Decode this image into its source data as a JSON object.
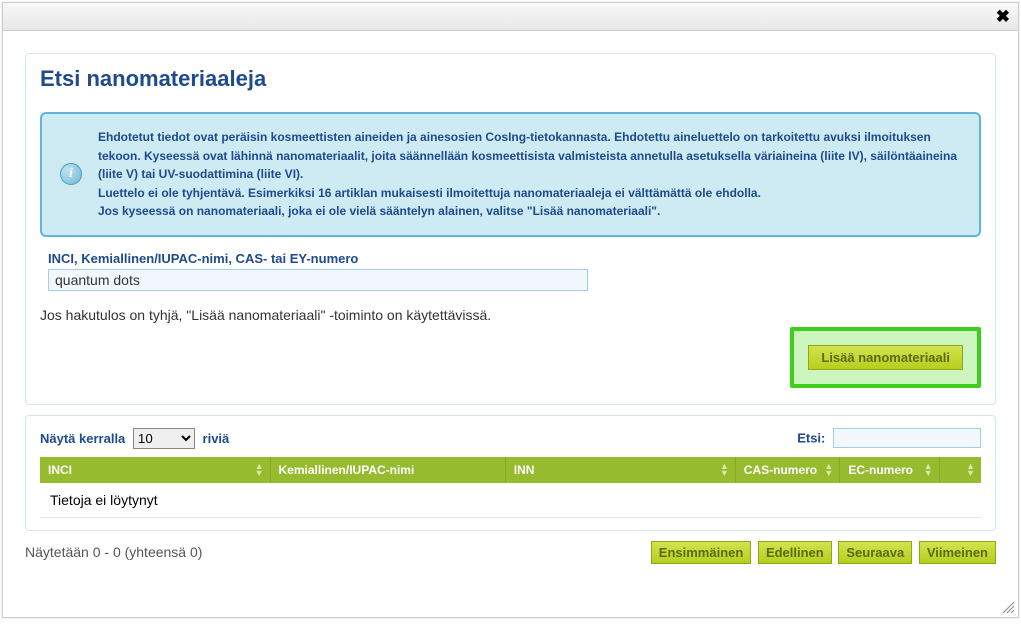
{
  "title": "Etsi nanomateriaaleja",
  "info": {
    "line1": "Ehdotetut tiedot ovat peräisin kosmeettisten aineiden ja ainesosien CosIng-tietokannasta. Ehdotettu aineluettelo on tarkoitettu avuksi ilmoituksen tekoon. Kyseessä ovat lähinnä nanomateriaalit, joita säännellään kosmeettisista valmisteista annetulla asetuksella väriaineina (liite IV), säilöntäaineina (liite V) tai UV-suodattimina (liite VI).",
    "line2": "Luettelo ei ole tyhjentävä. Esimerkiksi 16 artiklan mukaisesti ilmoitettuja nanomateriaaleja ei välttämättä ole ehdolla.",
    "line3": "Jos kyseessä on nanomateriaali, joka ei ole vielä sääntelyn alainen, valitse \"Lisää nanomateriaali\"."
  },
  "search": {
    "label": "INCI, Kemiallinen/IUPAC-nimi, CAS- tai EY-numero",
    "value": "quantum dots"
  },
  "helper": "Jos hakutulos on tyhjä, \"Lisää nanomateriaali\" -toiminto on käytettävissä.",
  "add_button": "Lisää nanomateriaali",
  "table": {
    "show_prefix": "Näytä kerralla",
    "show_suffix": "riviä",
    "show_value": "10",
    "filter_label": "Etsi:",
    "filter_value": "",
    "columns": {
      "inci": "INCI",
      "iupac": "Kemiallinen/IUPAC-nimi",
      "inn": "INN",
      "cas": "CAS-numero",
      "ec": "EC-numero",
      "actions": ""
    },
    "empty": "Tietoja ei löytynyt"
  },
  "footer": {
    "info": "Näytetään 0 - 0 (yhteensä 0)",
    "first": "Ensimmäinen",
    "prev": "Edellinen",
    "next": "Seuraava",
    "last": "Viimeinen"
  }
}
